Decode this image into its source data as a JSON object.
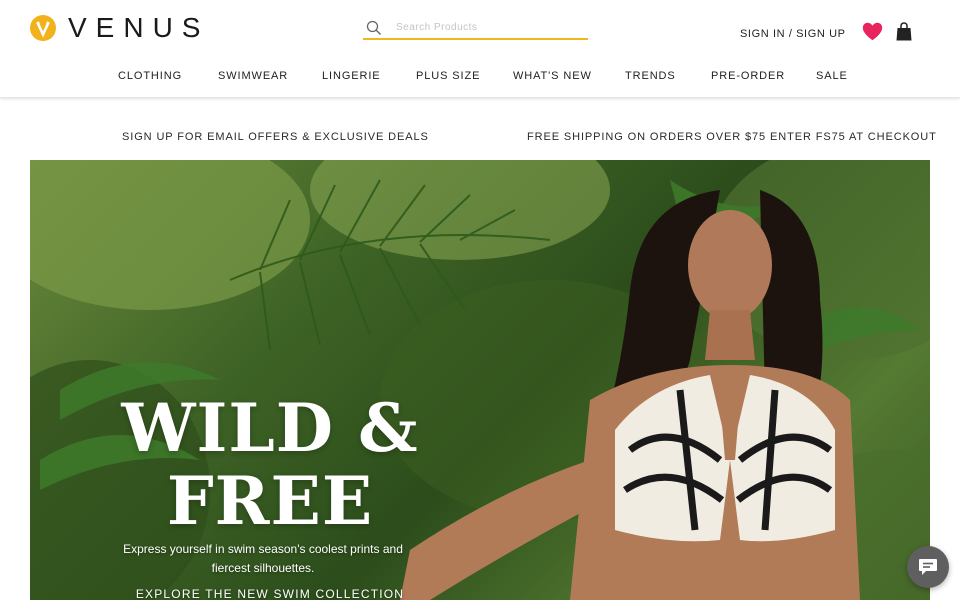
{
  "brand": {
    "name": "VENUS",
    "logo_icon": "venus-v-circle-logo",
    "accent": "#f2b21b"
  },
  "search": {
    "placeholder": "Search Products",
    "value": "",
    "icon": "search-icon"
  },
  "account": {
    "signin": "SIGN IN",
    "separator": "/",
    "signup": "SIGN UP"
  },
  "icons": {
    "wishlist": "heart-icon",
    "wishlist_color": "#e8245f",
    "bag": "shopping-bag-icon",
    "chat": "chat-icon"
  },
  "nav": {
    "items": [
      {
        "label": "CLOTHING"
      },
      {
        "label": "SWIMWEAR"
      },
      {
        "label": "LINGERIE"
      },
      {
        "label": "PLUS SIZE"
      },
      {
        "label": "WHAT'S NEW"
      },
      {
        "label": "TRENDS"
      },
      {
        "label": "PRE-ORDER"
      },
      {
        "label": "SALE"
      }
    ]
  },
  "promo": {
    "left": "SIGN UP FOR EMAIL OFFERS & EXCLUSIVE DEALS",
    "right": "FREE SHIPPING ON ORDERS OVER $75 ENTER FS75 AT CHECKOUT"
  },
  "hero": {
    "title_line1": "WILD &",
    "title_line2": "FREE",
    "subtitle": "Express yourself in swim season's coolest prints and fiercest silhouettes.",
    "cta": "EXPLORE THE NEW SWIM COLLECTION"
  }
}
